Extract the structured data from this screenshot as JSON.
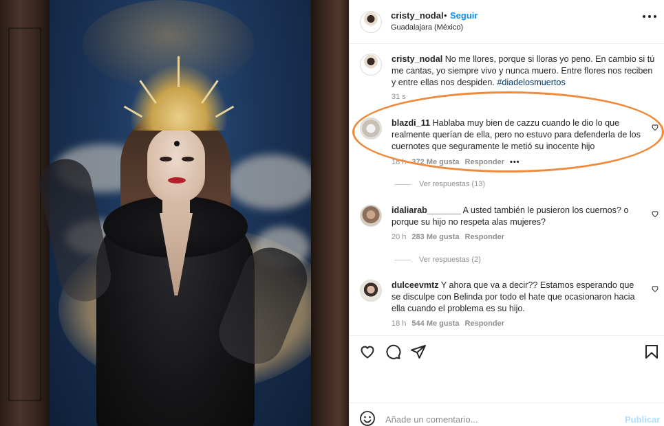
{
  "post": {
    "username": "cristy_nodal",
    "bullet": "•",
    "follow_label": "Seguir",
    "location": "Guadalajara (México)",
    "caption_user": "cristy_nodal",
    "caption_text": "No me llores, porque si lloras yo peno. En cambio si tú me cantas, yo siempre vivo y nunca muero. Entre flores nos reciben y entre ellas nos despiden.",
    "hashtag": "#diadelosmuertos",
    "caption_time": "31 s"
  },
  "comments": [
    {
      "user": "blazdi_11",
      "text": "Hablaba muy bien de cazzu cuando le dio lo que realmente querían de ella, pero no estuvo para defenderla de los cuernotes que seguramente le metió su inocente hijo",
      "time": "18 h",
      "likes": "372 Me gusta",
      "reply": "Responder",
      "more": "•••",
      "view_replies": "Ver respuestas (13)"
    },
    {
      "user": "idaliarab_______",
      "text": "A usted también le pusieron los cuernos? o porque su hijo no respeta alas mujeres?",
      "time": "20 h",
      "likes": "283 Me gusta",
      "reply": "Responder",
      "view_replies": "Ver respuestas (2)"
    },
    {
      "user": "dulceevmtz",
      "text": "Y ahora que va a decir?? Estamos esperando que se disculpe con Belinda por todo el hate que ocasionaron hacia ella cuando el problema es su hijo.",
      "time": "18 h",
      "likes": "544 Me gusta",
      "reply": "Responder"
    }
  ],
  "composer": {
    "placeholder": "Añade un comentario...",
    "publish": "Publicar"
  },
  "icons": {
    "like": "heart-icon",
    "comment": "comment-icon",
    "share": "paper-plane-icon",
    "save": "bookmark-icon",
    "emoji": "smiley-icon",
    "more": "more-dots-icon"
  },
  "colors": {
    "link_blue": "#0095f6",
    "hashtag": "#00376b",
    "highlight_orange": "#ef8a3c",
    "muted": "#8e8e8e"
  }
}
